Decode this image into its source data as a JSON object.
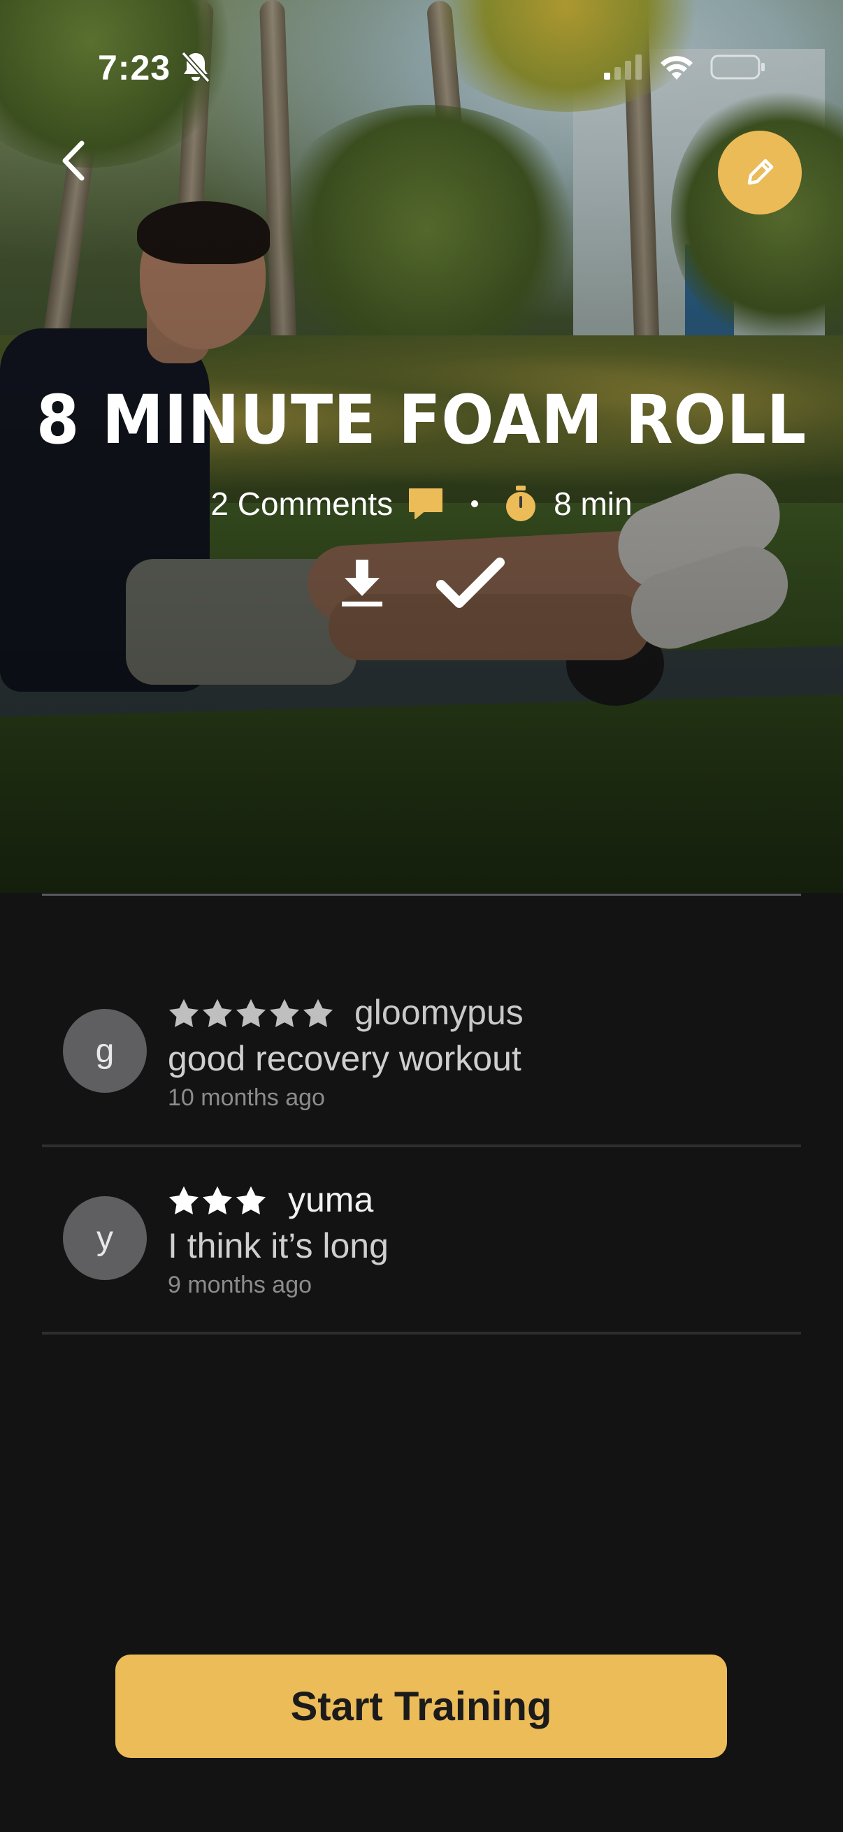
{
  "status_bar": {
    "time": "7:23",
    "icons": [
      "bell-slash-icon",
      "signal-icon",
      "wifi-icon",
      "battery-icon"
    ]
  },
  "nav": {
    "back_icon": "chevron-left-icon",
    "edit_icon": "pencil-icon"
  },
  "workout": {
    "title": "8 MINUTE FOAM ROLL",
    "comments_label": "2 Comments",
    "duration": "8 min",
    "actions": [
      "download-icon",
      "checkmark-icon"
    ]
  },
  "comments": [
    {
      "avatar_letter": "g",
      "rating": 5,
      "username": "gloomypus",
      "text": "good recovery workout",
      "time_ago": "10 months ago"
    },
    {
      "avatar_letter": "y",
      "rating": 3,
      "username": "yuma",
      "text": "I think it’s  long",
      "time_ago": "9 months ago"
    }
  ],
  "cta": {
    "label": "Start Training"
  },
  "colors": {
    "accent": "#ECBC58",
    "background": "#131314",
    "avatar": "#5F5F61",
    "star_active": "#FFFFFF",
    "star_muted": "#BFBFBF"
  }
}
